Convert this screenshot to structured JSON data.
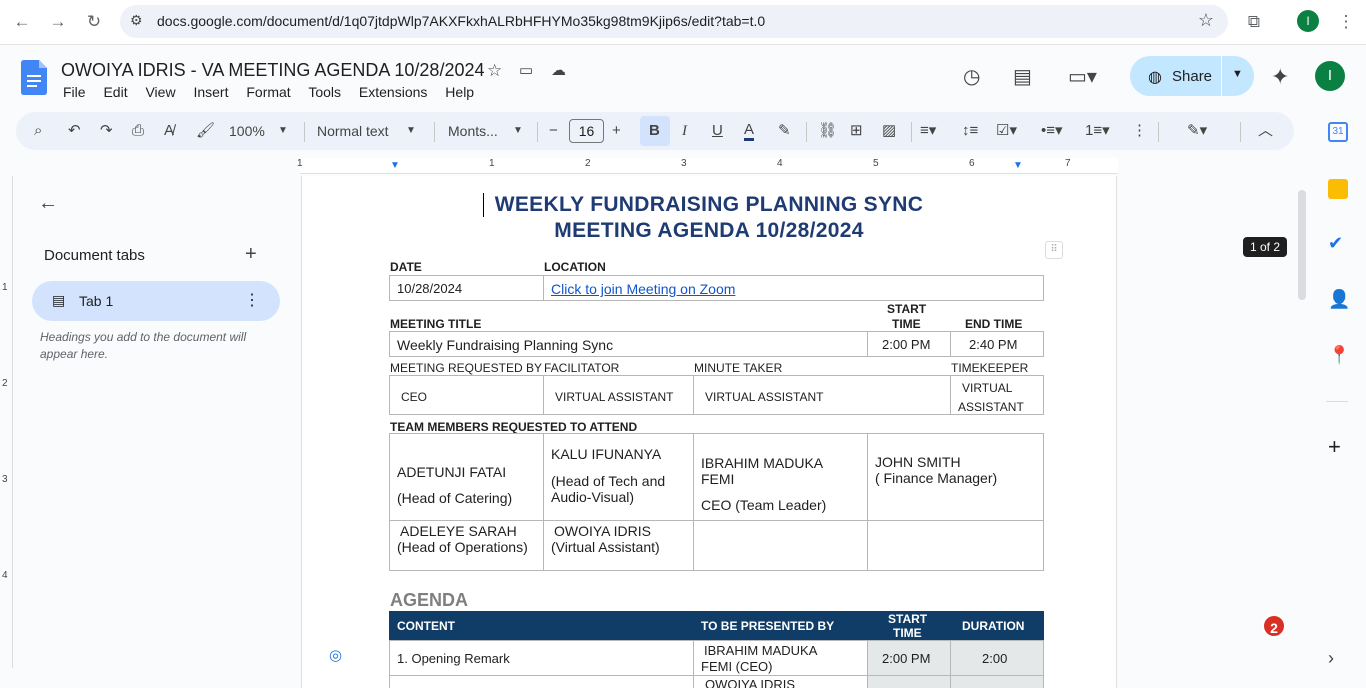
{
  "browser": {
    "url": "docs.google.com/document/d/1q07jtdpWlp7AKXFkxhALRbHFHYMo35kg98tm9Kjip6s/edit?tab=t.0",
    "profile_initial": "I"
  },
  "docs": {
    "title": "OWOIYA IDRIS - VA MEETING AGENDA 10/28/2024",
    "menus": [
      "File",
      "Edit",
      "View",
      "Insert",
      "Format",
      "Tools",
      "Extensions",
      "Help"
    ],
    "share_label": "Share",
    "avatar_initial": "I"
  },
  "toolbar": {
    "zoom": "100%",
    "style": "Normal text",
    "font": "Monts...",
    "font_size": "16"
  },
  "ruler": [
    "1",
    "1",
    "2",
    "3",
    "4",
    "5",
    "6",
    "7"
  ],
  "vruler": [
    "1",
    "2",
    "3",
    "4"
  ],
  "sidebar": {
    "heading": "Document tabs",
    "tab_label": "Tab 1",
    "note": "Headings you add to the document will appear here."
  },
  "page_count": "1 of 2",
  "notification_count": "2",
  "document": {
    "title_line1": "WEEKLY FUNDRAISING PLANNING SYNC",
    "title_line2": "MEETING AGENDA 10/28/2024",
    "date_label": "DATE",
    "location_label": "LOCATION",
    "date_value": "10/28/2024",
    "location_value": "Click to join Meeting on Zoom",
    "meeting_title_label": "MEETING TITLE",
    "start_time_label_1": "START",
    "start_time_label_2": "TIME",
    "end_time_label": "END TIME",
    "meeting_title_value": "Weekly Fundraising Planning Sync",
    "start_time_value": "2:00 PM",
    "end_time_value": "2:40 PM",
    "requested_by_label": "MEETING REQUESTED BY",
    "facilitator_label": "FACILITATOR",
    "minute_taker_label": "MINUTE TAKER",
    "timekeeper_label": "TIMEKEEPER",
    "requested_by_value": "CEO",
    "facilitator_value": "VIRTUAL ASSISTANT",
    "minute_taker_value": "VIRTUAL ASSISTANT",
    "timekeeper_value_1": "VIRTUAL",
    "timekeeper_value_2": "ASSISTANT",
    "team_label": "TEAM MEMBERS REQUESTED TO ATTEND",
    "members": [
      {
        "name": "ADETUNJI FATAI",
        "role": "(Head of Catering)"
      },
      {
        "name": "KALU IFUNANYA",
        "role": "(Head of Tech and Audio-Visual)"
      },
      {
        "name": "IBRAHIM MADUKA FEMI",
        "role": "CEO (Team Leader)"
      },
      {
        "name": "JOHN SMITH",
        "role": "( Finance Manager)"
      },
      {
        "name": "ADELEYE SARAH",
        "role": "(Head of Operations)"
      },
      {
        "name": "OWOIYA IDRIS",
        "role": "(Virtual Assistant)"
      }
    ],
    "agenda_heading": "AGENDA",
    "agenda_headers": {
      "content": "CONTENT",
      "presenter": "TO BE PRESENTED BY",
      "start_1": "START",
      "start_2": "TIME",
      "duration": "DURATION"
    },
    "agenda_rows": [
      {
        "content": "1.  Opening Remark",
        "presenter_1": "IBRAHIM MADUKA",
        "presenter_2": "FEMI (CEO)",
        "start": "2:00 PM",
        "duration": "2:00"
      },
      {
        "content": "",
        "presenter_1": "OWOIYA IDRIS",
        "presenter_2": "",
        "start": "",
        "duration": ""
      }
    ]
  }
}
